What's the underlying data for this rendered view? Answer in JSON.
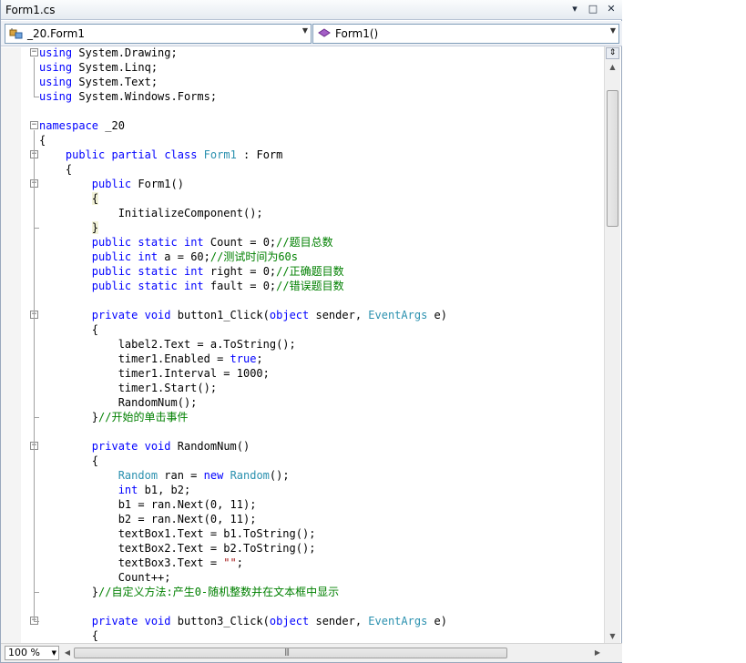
{
  "window": {
    "title": "Form1.cs"
  },
  "titlebar_buttons": {
    "dropdown": "▾",
    "restore": "□",
    "close": "✕"
  },
  "navbar": {
    "class_combo": {
      "value": "_20.Form1",
      "icon": "class-icon"
    },
    "member_combo": {
      "value": "Form1()",
      "icon": "method-icon"
    }
  },
  "editor": {
    "language": "C#",
    "lines": [
      [
        {
          "t": "using",
          "c": "kw"
        },
        {
          "t": " System.Drawing;"
        }
      ],
      [
        {
          "t": "using",
          "c": "kw"
        },
        {
          "t": " System.Linq;"
        }
      ],
      [
        {
          "t": "using",
          "c": "kw"
        },
        {
          "t": " System.Text;"
        }
      ],
      [
        {
          "t": "using",
          "c": "kw"
        },
        {
          "t": " System.Windows.Forms;"
        }
      ],
      [],
      [
        {
          "t": "namespace",
          "c": "kw"
        },
        {
          "t": " _20"
        }
      ],
      [
        {
          "t": "{"
        }
      ],
      [
        {
          "t": "    "
        },
        {
          "t": "public",
          "c": "kw"
        },
        {
          "t": " "
        },
        {
          "t": "partial",
          "c": "kw"
        },
        {
          "t": " "
        },
        {
          "t": "class",
          "c": "kw"
        },
        {
          "t": " "
        },
        {
          "t": "Form1",
          "c": "ty"
        },
        {
          "t": " : Form"
        }
      ],
      [
        {
          "t": "    {"
        }
      ],
      [
        {
          "t": "        "
        },
        {
          "t": "public",
          "c": "kw"
        },
        {
          "t": " Form1()"
        }
      ],
      [
        {
          "t": "        "
        },
        {
          "t": "{",
          "c": "hl"
        }
      ],
      [
        {
          "t": "            InitializeComponent();"
        }
      ],
      [
        {
          "t": "        "
        },
        {
          "t": "}",
          "c": "hl"
        }
      ],
      [
        {
          "t": "        "
        },
        {
          "t": "public",
          "c": "kw"
        },
        {
          "t": " "
        },
        {
          "t": "static",
          "c": "kw"
        },
        {
          "t": " "
        },
        {
          "t": "int",
          "c": "kw"
        },
        {
          "t": " Count = 0;"
        },
        {
          "t": "//题目总数",
          "c": "cm"
        }
      ],
      [
        {
          "t": "        "
        },
        {
          "t": "public",
          "c": "kw"
        },
        {
          "t": " "
        },
        {
          "t": "int",
          "c": "kw"
        },
        {
          "t": " a = 60;"
        },
        {
          "t": "//测试时间为60s",
          "c": "cm"
        }
      ],
      [
        {
          "t": "        "
        },
        {
          "t": "public",
          "c": "kw"
        },
        {
          "t": " "
        },
        {
          "t": "static",
          "c": "kw"
        },
        {
          "t": " "
        },
        {
          "t": "int",
          "c": "kw"
        },
        {
          "t": " right = 0;"
        },
        {
          "t": "//正确题目数",
          "c": "cm"
        }
      ],
      [
        {
          "t": "        "
        },
        {
          "t": "public",
          "c": "kw"
        },
        {
          "t": " "
        },
        {
          "t": "static",
          "c": "kw"
        },
        {
          "t": " "
        },
        {
          "t": "int",
          "c": "kw"
        },
        {
          "t": " fault = 0;"
        },
        {
          "t": "//错误题目数",
          "c": "cm"
        }
      ],
      [],
      [
        {
          "t": "        "
        },
        {
          "t": "private",
          "c": "kw"
        },
        {
          "t": " "
        },
        {
          "t": "void",
          "c": "kw"
        },
        {
          "t": " button1_Click("
        },
        {
          "t": "object",
          "c": "kw"
        },
        {
          "t": " sender, "
        },
        {
          "t": "EventArgs",
          "c": "ty"
        },
        {
          "t": " e)"
        }
      ],
      [
        {
          "t": "        {"
        }
      ],
      [
        {
          "t": "            label2.Text = a.ToString();"
        }
      ],
      [
        {
          "t": "            timer1.Enabled = "
        },
        {
          "t": "true",
          "c": "kw"
        },
        {
          "t": ";"
        }
      ],
      [
        {
          "t": "            timer1.Interval = 1000;"
        }
      ],
      [
        {
          "t": "            timer1.Start();"
        }
      ],
      [
        {
          "t": "            RandomNum();"
        }
      ],
      [
        {
          "t": "        }"
        },
        {
          "t": "//开始的单击事件",
          "c": "cm"
        }
      ],
      [],
      [
        {
          "t": "        "
        },
        {
          "t": "private",
          "c": "kw"
        },
        {
          "t": " "
        },
        {
          "t": "void",
          "c": "kw"
        },
        {
          "t": " RandomNum()"
        }
      ],
      [
        {
          "t": "        {"
        }
      ],
      [
        {
          "t": "            "
        },
        {
          "t": "Random",
          "c": "ty"
        },
        {
          "t": " ran = "
        },
        {
          "t": "new",
          "c": "kw"
        },
        {
          "t": " "
        },
        {
          "t": "Random",
          "c": "ty"
        },
        {
          "t": "();"
        }
      ],
      [
        {
          "t": "            "
        },
        {
          "t": "int",
          "c": "kw"
        },
        {
          "t": " b1, b2;"
        }
      ],
      [
        {
          "t": "            b1 = ran.Next(0, 11);"
        }
      ],
      [
        {
          "t": "            b2 = ran.Next(0, 11);"
        }
      ],
      [
        {
          "t": "            textBox1.Text = b1.ToString();"
        }
      ],
      [
        {
          "t": "            textBox2.Text = b2.ToString();"
        }
      ],
      [
        {
          "t": "            textBox3.Text = "
        },
        {
          "t": "\"\"",
          "c": "st"
        },
        {
          "t": ";"
        }
      ],
      [
        {
          "t": "            Count++;"
        }
      ],
      [
        {
          "t": "        }"
        },
        {
          "t": "//自定义方法:产生0-随机整数并在文本框中显示",
          "c": "cm"
        }
      ],
      [],
      [
        {
          "t": "        "
        },
        {
          "t": "private",
          "c": "kw"
        },
        {
          "t": " "
        },
        {
          "t": "void",
          "c": "kw"
        },
        {
          "t": " button3_Click("
        },
        {
          "t": "object",
          "c": "kw"
        },
        {
          "t": " sender, "
        },
        {
          "t": "EventArgs",
          "c": "ty"
        },
        {
          "t": " e)"
        }
      ],
      [
        {
          "t": "        {"
        }
      ]
    ]
  },
  "statusbar": {
    "zoom": "100 %"
  },
  "colors": {
    "keyword": "#0000ff",
    "type": "#2b91af",
    "comment": "#008000",
    "string": "#a31515",
    "titlebar": "#e6ebf1"
  }
}
